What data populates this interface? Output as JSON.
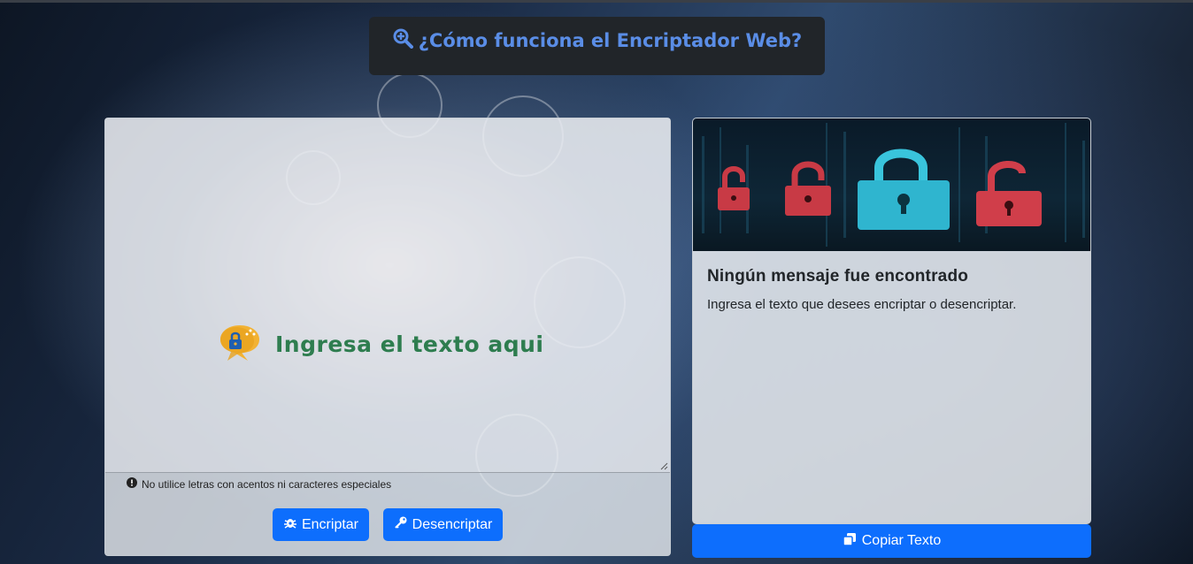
{
  "header": {
    "title": "¿Cómo funciona el Encriptador Web?",
    "icon": "magnifier-plus-icon",
    "color": "#5a8de6"
  },
  "input": {
    "placeholder": "Ingresa el texto aqui",
    "placeholder_color": "#2e7d4f",
    "hint": "No utilice letras con acentos ni caracteres especiales"
  },
  "buttons": {
    "encrypt_label": "Encriptar",
    "decrypt_label": "Desencriptar",
    "copy_label": "Copiar Texto",
    "accent": "#0d6efd"
  },
  "output": {
    "title": "Ningún mensaje fue encontrado",
    "text": "Ingresa el texto que desees encriptar o desencriptar."
  }
}
